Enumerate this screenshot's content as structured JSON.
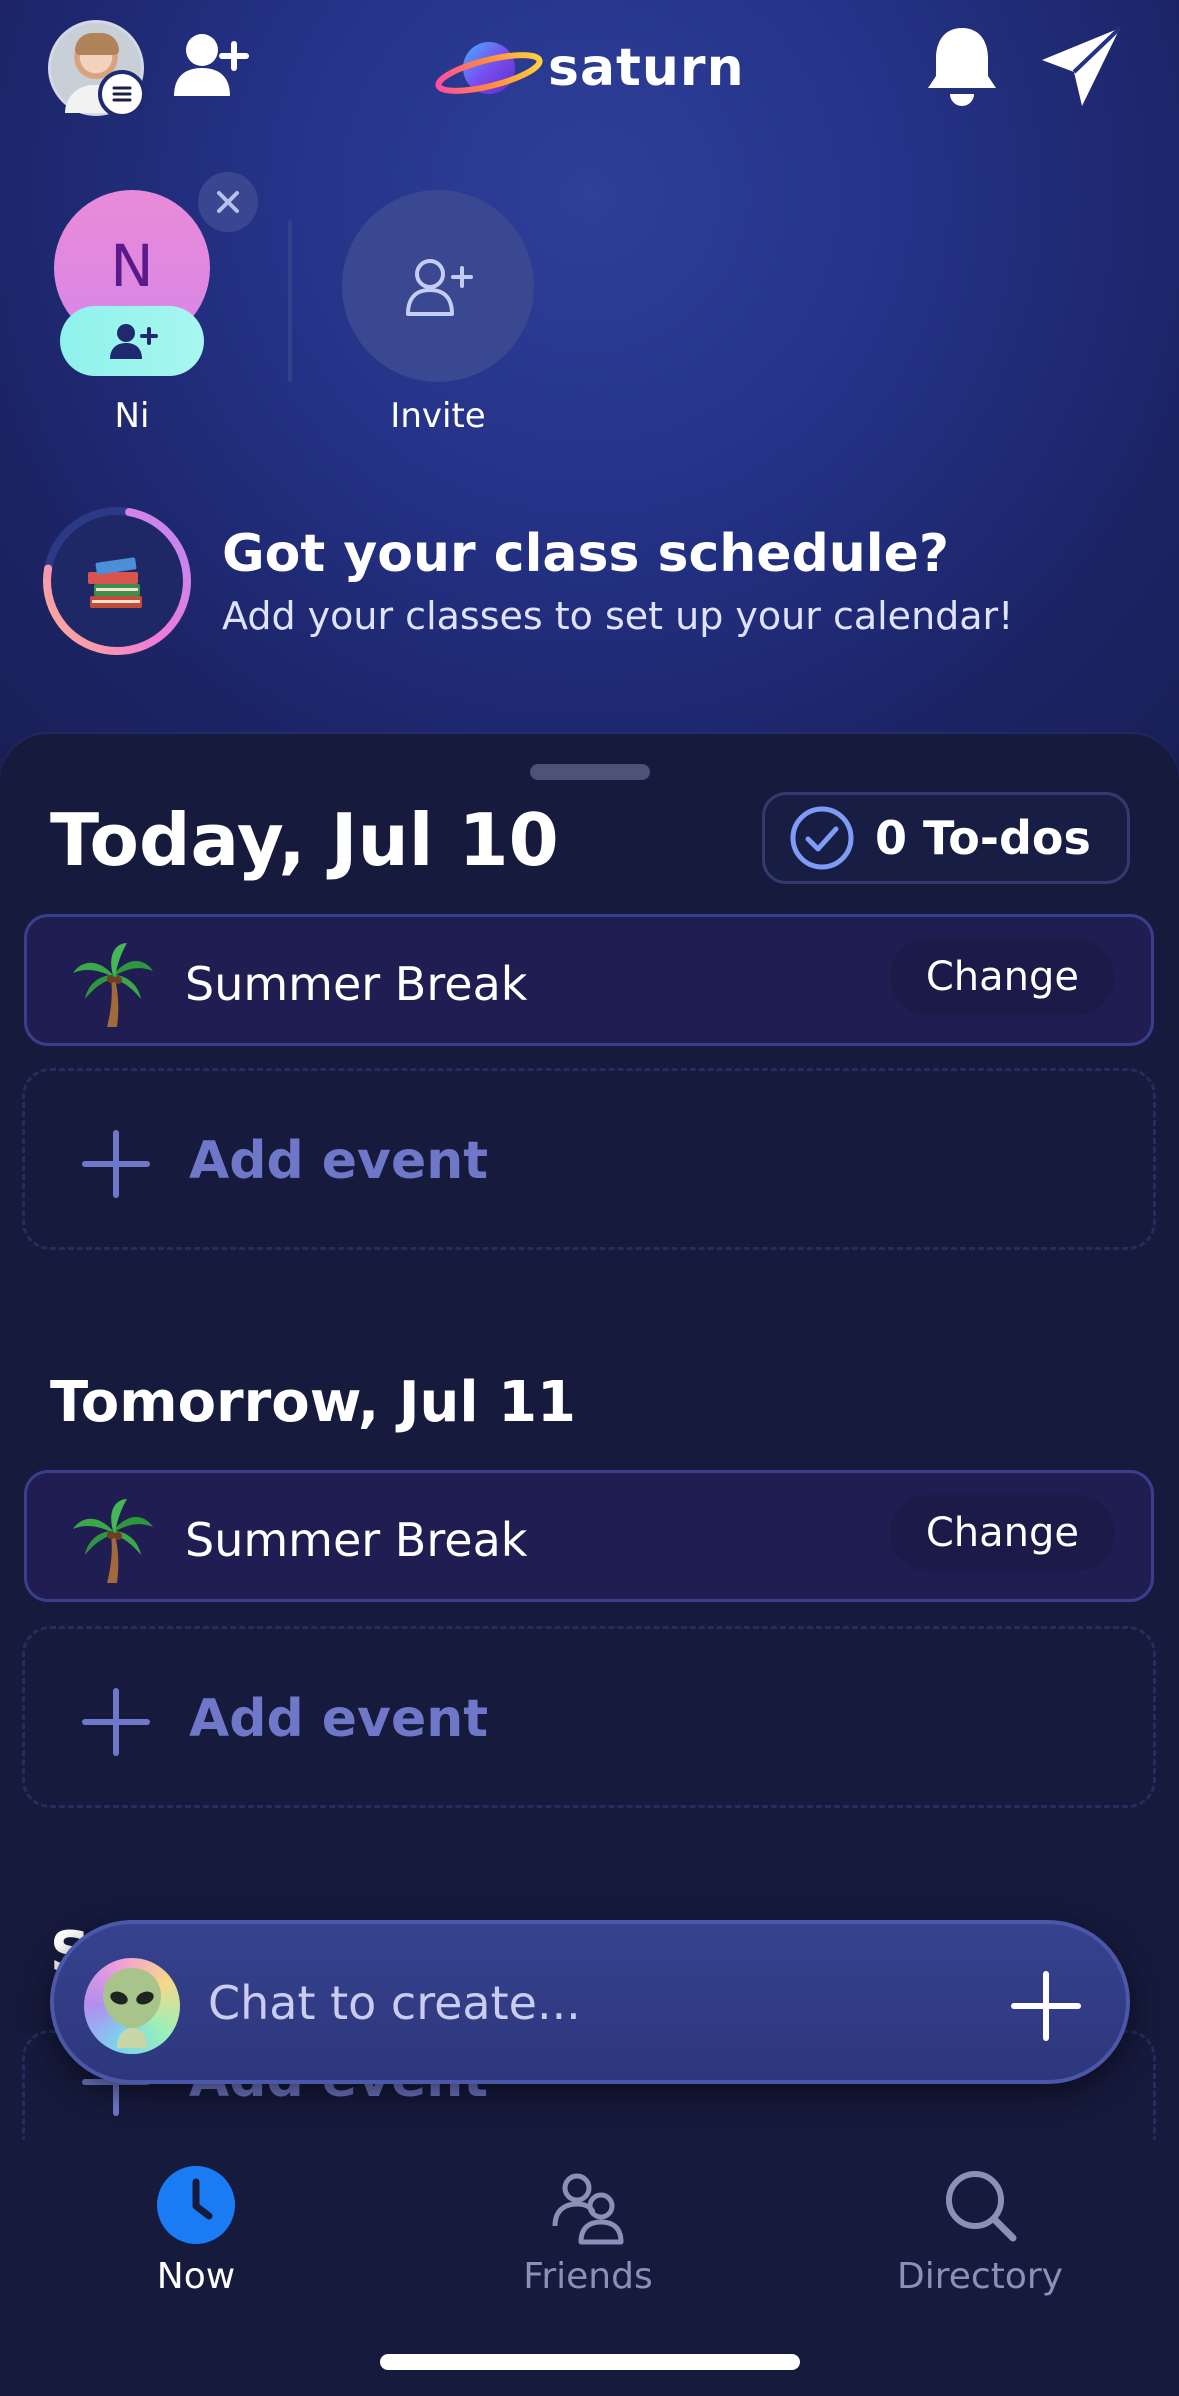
{
  "app": {
    "logo_text": "saturn"
  },
  "friends": [
    {
      "initial": "N",
      "name": "Ni"
    },
    {
      "name": "Invite"
    }
  ],
  "schedule_prompt": {
    "title": "Got your class schedule?",
    "subtitle": "Add your classes to set up your calendar!"
  },
  "days": [
    {
      "title": "Today, Jul 10",
      "event": {
        "name": "Summer Break",
        "action": "Change"
      },
      "add_label": "Add event"
    },
    {
      "title": "Tomorrow, Jul 11",
      "event": {
        "name": "Summer Break",
        "action": "Change"
      },
      "add_label": "Add event"
    },
    {
      "title": "S",
      "add_label": "Add event"
    }
  ],
  "todos": {
    "label": "0 To-dos"
  },
  "chat": {
    "placeholder": "Chat to create..."
  },
  "nav": [
    {
      "label": "Now",
      "icon": "clock-icon",
      "active": true
    },
    {
      "label": "Friends",
      "icon": "friends-icon",
      "active": false
    },
    {
      "label": "Directory",
      "icon": "search-icon",
      "active": false
    }
  ],
  "colors": {
    "accent_blue": "#1a7cf5",
    "add_event_text": "#6f78c8",
    "ni_avatar": "#e88ad8",
    "ni_add_badge": "#8ef2ec"
  }
}
